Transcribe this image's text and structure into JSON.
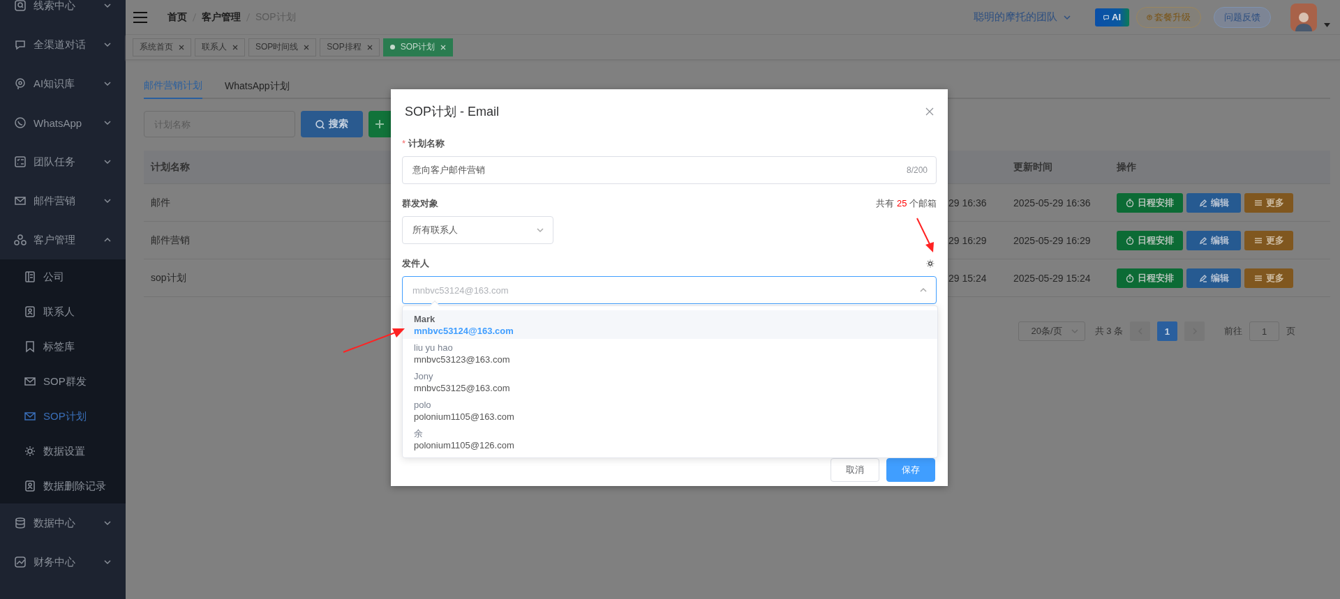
{
  "sidebar": {
    "items": [
      {
        "label": "线索中心",
        "expanded": false
      },
      {
        "label": "全渠道对话",
        "expanded": false
      },
      {
        "label": "AI知识库",
        "expanded": false
      },
      {
        "label": "WhatsApp",
        "expanded": false
      },
      {
        "label": "团队任务",
        "expanded": false
      },
      {
        "label": "邮件营销",
        "expanded": false
      },
      {
        "label": "客户管理",
        "expanded": true,
        "children": [
          {
            "label": "公司",
            "selected": false
          },
          {
            "label": "联系人",
            "selected": false
          },
          {
            "label": "标签库",
            "selected": false
          },
          {
            "label": "SOP群发",
            "selected": false
          },
          {
            "label": "SOP计划",
            "selected": true
          },
          {
            "label": "数据设置",
            "selected": false
          },
          {
            "label": "数据删除记录",
            "selected": false
          }
        ]
      },
      {
        "label": "数据中心",
        "expanded": false
      },
      {
        "label": "财务中心",
        "expanded": false
      }
    ]
  },
  "header": {
    "breadcrumb": [
      "首页",
      "客户管理",
      "SOP计划"
    ],
    "team": "聪明的摩托的团队",
    "ai_button": "AI",
    "upgrade_button": "套餐升级",
    "feedback_button": "问题反馈"
  },
  "open_tabs": [
    {
      "label": "系统首页",
      "selected": false
    },
    {
      "label": "联系人",
      "selected": false
    },
    {
      "label": "SOP时间线",
      "selected": false
    },
    {
      "label": "SOP排程",
      "selected": false
    },
    {
      "label": "SOP计划",
      "selected": true
    }
  ],
  "page": {
    "tabs": [
      {
        "label": "邮件营销计划",
        "selected": true
      },
      {
        "label": "WhatsApp计划",
        "selected": false
      }
    ],
    "search": {
      "placeholder": "计划名称"
    },
    "search_button": "搜索",
    "table": {
      "columns": [
        "计划名称",
        "更新时间",
        "操作"
      ],
      "rows": [
        {
          "name": "邮件",
          "column_2": "29 16:36",
          "updated": "2025-05-29 16:36",
          "actions": [
            "日程安排",
            "编辑",
            "更多"
          ]
        },
        {
          "name": "邮件营销",
          "column_2": "29 16:29",
          "updated": "2025-05-29 16:29",
          "actions": [
            "日程安排",
            "编辑",
            "更多"
          ]
        },
        {
          "name": "sop计划",
          "column_2": "29 15:24",
          "updated": "2025-05-29 15:24",
          "actions": [
            "日程安排",
            "编辑",
            "更多"
          ]
        }
      ]
    },
    "pagination": {
      "page_size": "20条/页",
      "total": "共 3 条",
      "pages": [
        {
          "label": "1",
          "selected": true
        }
      ],
      "goto_label": "前往",
      "goto_value": "1",
      "goto_suffix": "页"
    }
  },
  "dialog": {
    "title": "SOP计划 - Email",
    "fields": [
      {
        "kind": "text",
        "label": "计划名称",
        "required_mark": "*",
        "value": "意向客户邮件营销",
        "counter": "8/200"
      },
      {
        "kind": "select",
        "label": "群发对象",
        "value": "所有联系人",
        "note_prefix": "共有",
        "note_count": "25",
        "note_suffix": "个邮箱"
      },
      {
        "kind": "combobox",
        "label": "发件人",
        "placeholder": "mnbvc53124@163.com",
        "open": true,
        "options": [
          {
            "name": "Mark",
            "email": "mnbvc53124@163.com",
            "selected": true
          },
          {
            "name": "liu yu hao",
            "email": "mnbvc53123@163.com",
            "selected": false
          },
          {
            "name": "Jony",
            "email": "mnbvc53125@163.com",
            "selected": false
          },
          {
            "name": "polo",
            "email": "polonium1105@163.com",
            "selected": false
          },
          {
            "name": "余",
            "email": "polonium1105@126.com",
            "selected": false
          }
        ]
      }
    ],
    "buttons": [
      {
        "label": "取消",
        "kind": "default"
      },
      {
        "label": "保存",
        "kind": "primary"
      }
    ]
  }
}
